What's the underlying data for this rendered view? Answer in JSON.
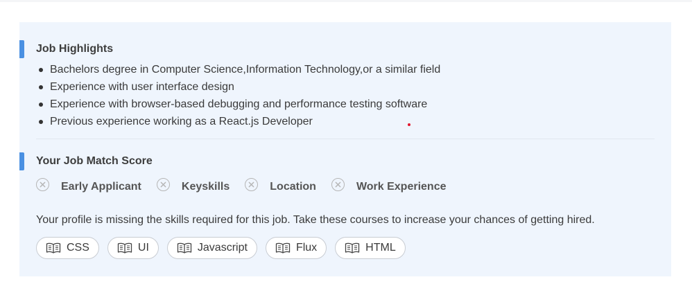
{
  "highlights": {
    "title": "Job Highlights",
    "items": [
      "Bachelors degree in Computer Science,Information Technology,or a similar field",
      "Experience with user interface design",
      "Experience with browser-based debugging and performance testing software",
      "Previous experience working as a React.js Developer"
    ]
  },
  "match": {
    "title": "Your Job Match Score",
    "criteria": [
      {
        "label": "Early Applicant",
        "icon": "x-circle-icon",
        "met": false
      },
      {
        "label": "Keyskills",
        "icon": "x-circle-icon",
        "met": false
      },
      {
        "label": "Location",
        "icon": "x-circle-icon",
        "met": false
      },
      {
        "label": "Work Experience",
        "icon": "x-circle-icon",
        "met": false
      }
    ],
    "missing_text": "Your profile is missing the skills required for this job. Take these courses to increase your chances of getting hired.",
    "courses": [
      {
        "label": "CSS",
        "icon": "book-icon"
      },
      {
        "label": "UI",
        "icon": "book-icon"
      },
      {
        "label": "Javascript",
        "icon": "book-icon"
      },
      {
        "label": "Flux",
        "icon": "book-icon"
      },
      {
        "label": "HTML",
        "icon": "book-icon"
      }
    ]
  },
  "colors": {
    "card_background": "#eff5fd",
    "accent": "#4a90e2",
    "red_dot": "#e2162e"
  }
}
